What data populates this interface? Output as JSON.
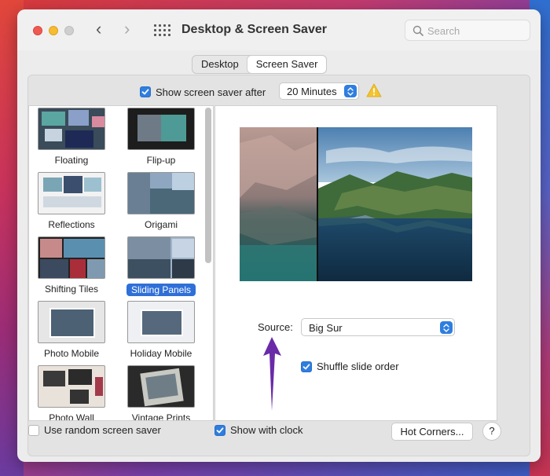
{
  "window": {
    "title": "Desktop & Screen Saver"
  },
  "search": {
    "placeholder": "Search"
  },
  "tabs": [
    {
      "label": "Desktop",
      "active": false
    },
    {
      "label": "Screen Saver",
      "active": true
    }
  ],
  "show_after": {
    "label": "Show screen saver after",
    "checked": true,
    "value": "20 Minutes"
  },
  "savers": [
    {
      "name": "Floating",
      "selected": false
    },
    {
      "name": "Flip-up",
      "selected": false
    },
    {
      "name": "Reflections",
      "selected": false
    },
    {
      "name": "Origami",
      "selected": false
    },
    {
      "name": "Shifting Tiles",
      "selected": false
    },
    {
      "name": "Sliding Panels",
      "selected": true
    },
    {
      "name": "Photo Mobile",
      "selected": false
    },
    {
      "name": "Holiday Mobile",
      "selected": false
    },
    {
      "name": "Photo Wall",
      "selected": false
    },
    {
      "name": "Vintage Prints",
      "selected": false
    }
  ],
  "options": {
    "source_label": "Source:",
    "source_value": "Big Sur",
    "shuffle_label": "Shuffle slide order",
    "shuffle_checked": true
  },
  "bottom": {
    "random_label": "Use random screen saver",
    "random_checked": false,
    "clock_label": "Show with clock",
    "clock_checked": true,
    "hot_corners": "Hot Corners...",
    "help": "?"
  },
  "colors": {
    "accent": "#2f7ee0",
    "warning": "#f4c430",
    "annotation_arrow": "#6a2aa8"
  },
  "icons": [
    "search-icon",
    "chevron-left-icon",
    "chevron-right-icon",
    "grid-icon",
    "warning-icon",
    "checkmark-icon",
    "stepper-icon",
    "arrow-annotation-icon"
  ]
}
